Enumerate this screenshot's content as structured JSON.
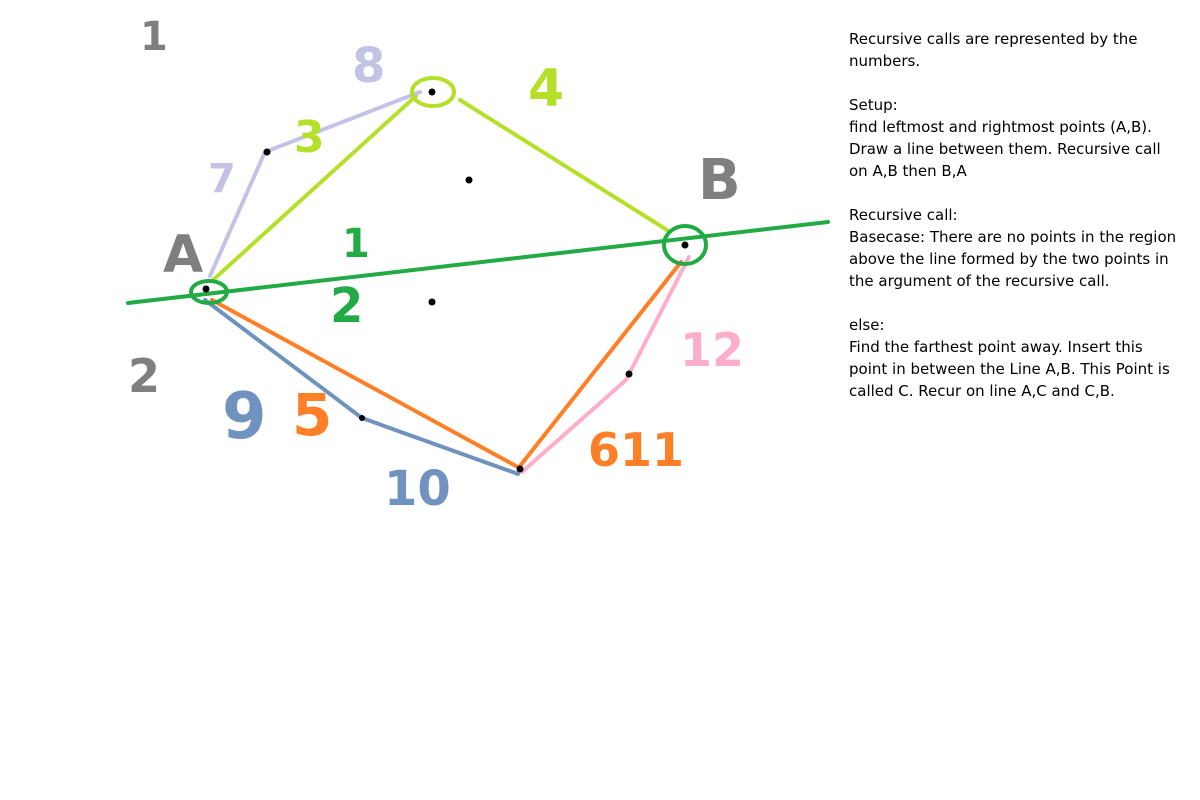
{
  "labels": {
    "point_a": "A",
    "point_b": "B",
    "n1_corner": "1",
    "n2_corner": "2",
    "n1": "1",
    "n2": "2",
    "n3": "3",
    "n4": "4",
    "n5": "5",
    "n7": "7",
    "n8": "8",
    "n9": "9",
    "n10": "10",
    "n11": "611",
    "n12": "12"
  },
  "colors": {
    "axis_line": "#22aa44",
    "yellow_green": "#b5e02a",
    "lavender": "#c3c3e6",
    "orange": "#ff7f27",
    "steel_blue": "#7092be",
    "pink": "#ffaec9",
    "gray": "#7f7f7f",
    "dark": "#000000"
  },
  "notes": {
    "intro": "Recursive calls are represented by the numbers.",
    "setup_title": "Setup:",
    "setup_body": "find leftmost and rightmost points (A,B). Draw a line between them. Recursive call on A,B then B,A",
    "call_title": "Recursive call:",
    "call_base": "Basecase: There are no points in the region above the line formed by the two points in the argument of the recursive call.",
    "else_title": "else:",
    "else_body": "Find the farthest point away. Insert this point in between the Line A,B. This Point is called C.  Recur on line A,C and C,B."
  }
}
